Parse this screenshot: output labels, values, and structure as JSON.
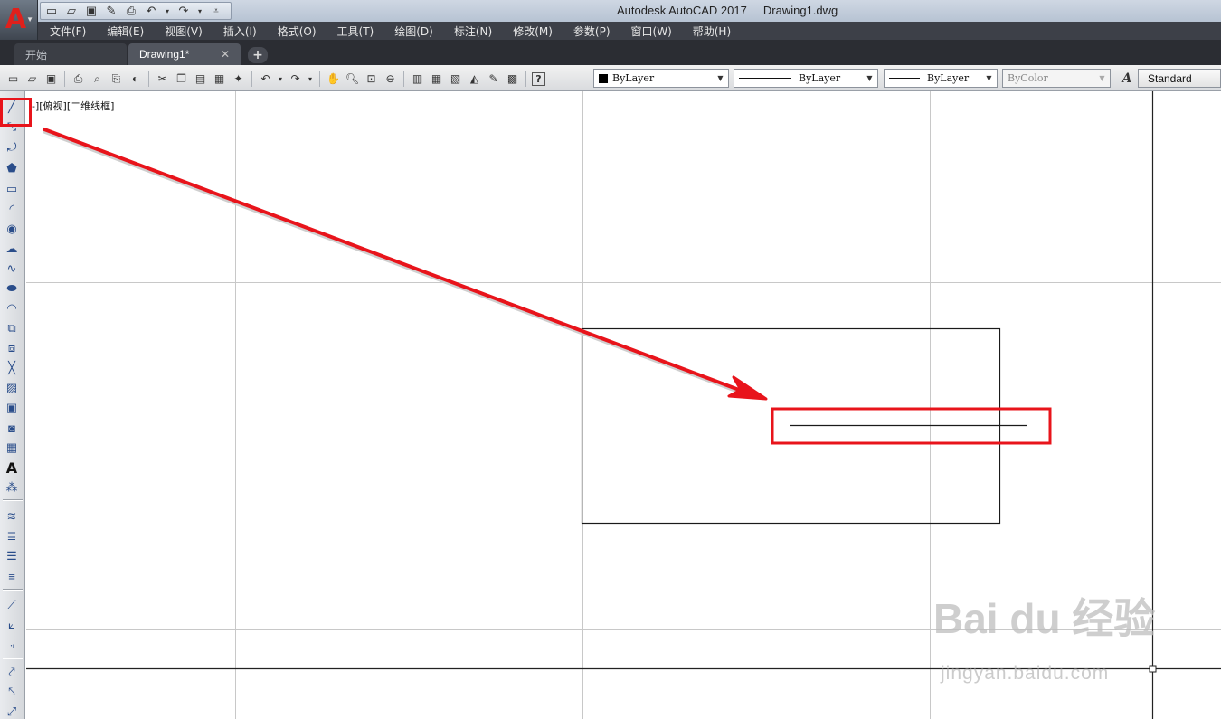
{
  "title_bar": {
    "app_name": "Autodesk AutoCAD 2017",
    "file_name": "Drawing1.dwg"
  },
  "app_button": {
    "logo": "A"
  },
  "quick_access": [
    {
      "name": "new-icon",
      "glyph": "🗋"
    },
    {
      "name": "open-icon",
      "glyph": "📂"
    },
    {
      "name": "save-icon",
      "glyph": "💾"
    },
    {
      "name": "saveas-icon",
      "glyph": "✎"
    },
    {
      "name": "print-icon",
      "glyph": "🖶"
    },
    {
      "name": "undo-icon",
      "glyph": "↶"
    },
    {
      "name": "redo-icon",
      "glyph": "↷"
    },
    {
      "name": "customize-icon",
      "glyph": "▾"
    }
  ],
  "menu": [
    "文件(F)",
    "编辑(E)",
    "视图(V)",
    "插入(I)",
    "格式(O)",
    "工具(T)",
    "绘图(D)",
    "标注(N)",
    "修改(M)",
    "参数(P)",
    "窗口(W)",
    "帮助(H)"
  ],
  "tabs": {
    "start": "开始",
    "drawing": "Drawing1*",
    "close": "✕",
    "add": "+"
  },
  "toolbar": {
    "color_combo": "ByLayer",
    "linetype_combo": "ByLayer",
    "lineweight_combo": "ByLayer",
    "plotstyle_combo": "ByColor",
    "text_style": "Standard"
  },
  "viewport_label": "-][俯视][二维线框]",
  "watermark": {
    "main": "Bai du 经验",
    "sub": "jingyan.baidu.com"
  },
  "colors": {
    "highlight_red": "#e8141b",
    "menubar_bg": "#3d4048",
    "tabbar_bg": "#2b2d33"
  }
}
